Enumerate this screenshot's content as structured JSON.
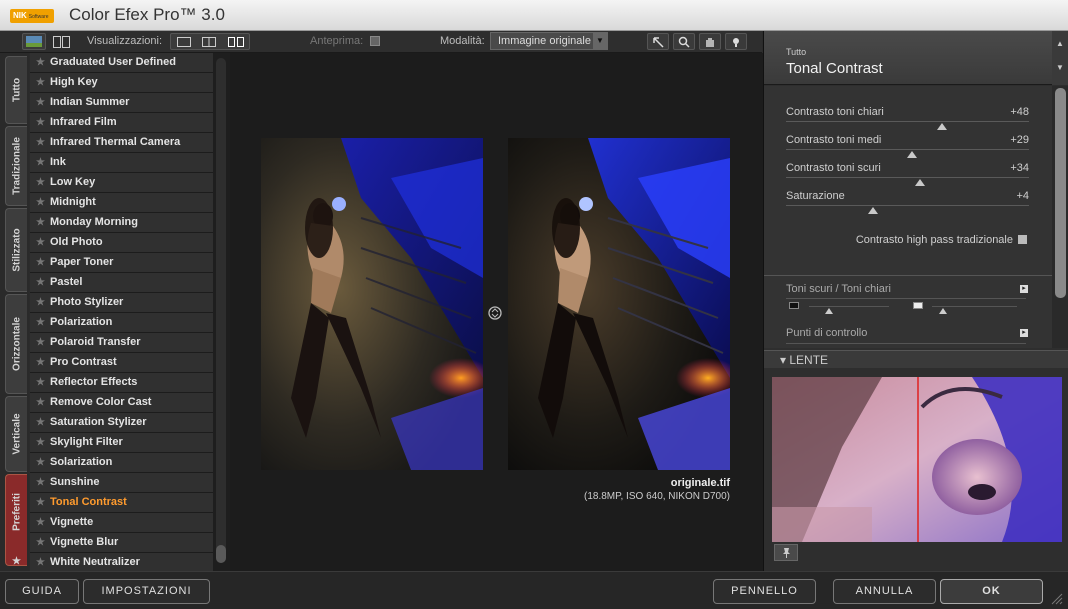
{
  "window": {
    "logo_text": "NIK",
    "logo_sub": "Software",
    "title": "Color Efex Pro™ 3.0"
  },
  "toolbar": {
    "views_label": "Visualizzazioni:",
    "preview_label": "Anteprima:",
    "mode_label": "Modalità:",
    "mode_value": "Immagine originale"
  },
  "tabs": [
    "Tutto",
    "Tradizionale",
    "Stilizzato",
    "Orizzontale",
    "Verticale",
    "Preferiti"
  ],
  "filters": [
    "Graduated User Defined",
    "High Key",
    "Indian Summer",
    "Infrared Film",
    "Infrared Thermal Camera",
    "Ink",
    "Low Key",
    "Midnight",
    "Monday Morning",
    "Old Photo",
    "Paper Toner",
    "Pastel",
    "Photo Stylizer",
    "Polarization",
    "Polaroid Transfer",
    "Pro Contrast",
    "Reflector Effects",
    "Remove Color Cast",
    "Saturation Stylizer",
    "Skylight Filter",
    "Solarization",
    "Sunshine",
    "Tonal Contrast",
    "Vignette",
    "Vignette Blur",
    "White Neutralizer"
  ],
  "active_filter": "Tonal Contrast",
  "preview": {
    "filename": "originale.tif",
    "fileinfo": "(18.8MP, ISO 640, NIKON D700)"
  },
  "panel": {
    "category": "Tutto",
    "filter_name": "Tonal Contrast",
    "sliders": [
      {
        "label": "Contrasto toni chiari",
        "value": "+48",
        "level": 0.64
      },
      {
        "label": "Contrasto toni medi",
        "value": "+29",
        "level": 0.52
      },
      {
        "label": "Contrasto toni scuri",
        "value": "+34",
        "level": 0.55
      },
      {
        "label": "Saturazione",
        "value": "+4",
        "level": 0.36
      }
    ],
    "checkbox_label": "Contrasto high pass tradizionale",
    "section1": "Toni scuri / Toni chiari",
    "section2": "Punti di controllo",
    "lens_label": "LENTE"
  },
  "buttons": {
    "guida": "GUIDA",
    "impostazioni": "IMPOSTAZIONI",
    "pennello": "PENNELLO",
    "annulla": "ANNULLA",
    "ok": "OK"
  }
}
